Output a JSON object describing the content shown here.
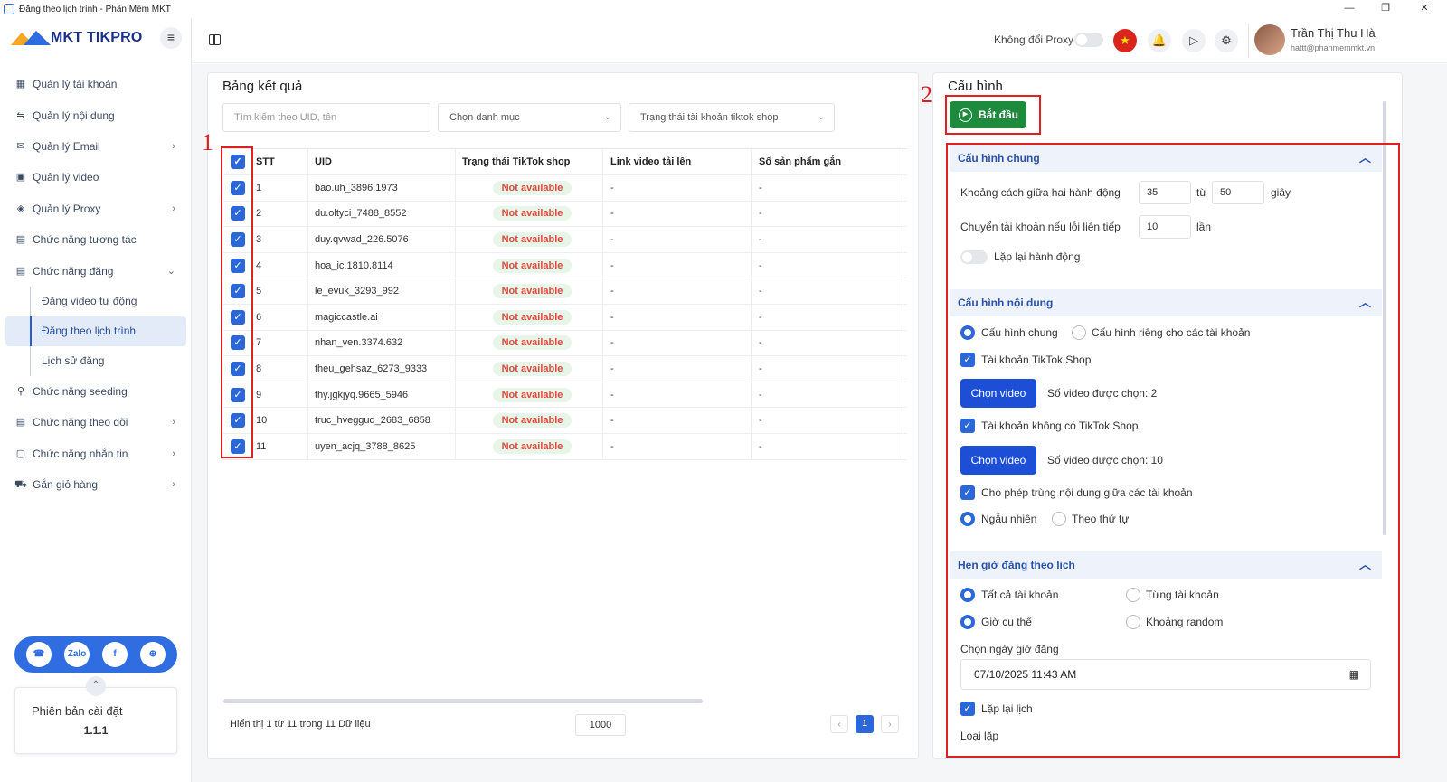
{
  "window": {
    "title": "Đăng theo lịch trình - Phần Mềm MKT",
    "minimize": "—",
    "restore": "❐",
    "close": "✕"
  },
  "brand": {
    "name": "MKT TIKPRO"
  },
  "sidebar": {
    "items": [
      {
        "label": "Quản lý tài khoản",
        "icon": "▦"
      },
      {
        "label": "Quản lý nội dung",
        "icon": "⇋"
      },
      {
        "label": "Quản lý Email",
        "icon": "✉",
        "chev": "›"
      },
      {
        "label": "Quản lý video",
        "icon": "▣"
      },
      {
        "label": "Quản lý Proxy",
        "icon": "◈",
        "chev": "›"
      },
      {
        "label": "Chức năng tương tác",
        "icon": "▤"
      },
      {
        "label": "Chức năng đăng",
        "icon": "▤",
        "chev": "⌄"
      }
    ],
    "subitems": [
      {
        "label": "Đăng video tự động"
      },
      {
        "label": "Đăng theo lịch trình"
      },
      {
        "label": "Lịch sử đăng"
      }
    ],
    "items_after": [
      {
        "label": "Chức năng seeding",
        "icon": "⚲"
      },
      {
        "label": "Chức năng theo dõi",
        "icon": "▤",
        "chev": "›"
      },
      {
        "label": "Chức năng nhắn tin",
        "icon": "▢",
        "chev": "›"
      },
      {
        "label": "Gắn giỏ hàng",
        "icon": "⛟",
        "chev": "›"
      }
    ],
    "social": [
      "☎",
      "Zalo",
      "f",
      "⊕"
    ],
    "version_label": "Phiên bản cài đặt",
    "version": "1.1.1"
  },
  "header": {
    "proxy_label": "Không đổi Proxy",
    "user_name": "Trần Thị Thu Hà",
    "user_email": "hattt@phanmemmkt.vn"
  },
  "results": {
    "title": "Bảng kết quả",
    "search_placeholder": "Tìm kiếm theo UID, tên",
    "category_select": "Chọn danh mục",
    "status_select": "Trạng thái tài khoản tiktok shop",
    "columns": [
      "STT",
      "UID",
      "Trạng thái TikTok shop",
      "Link video tải lên",
      "Số sản phẩm gắn"
    ],
    "rows": [
      {
        "stt": "1",
        "uid": "bao.uh_3896.1973",
        "status": "Not available",
        "link": "-",
        "count": "-"
      },
      {
        "stt": "2",
        "uid": "du.oltyci_7488_8552",
        "status": "Not available",
        "link": "-",
        "count": "-"
      },
      {
        "stt": "3",
        "uid": "duy.qvwad_226.5076",
        "status": "Not available",
        "link": "-",
        "count": "-"
      },
      {
        "stt": "4",
        "uid": "hoa_ic.1810.8114",
        "status": "Not available",
        "link": "-",
        "count": "-"
      },
      {
        "stt": "5",
        "uid": "le_evuk_3293_992",
        "status": "Not available",
        "link": "-",
        "count": "-"
      },
      {
        "stt": "6",
        "uid": "magiccastle.ai",
        "status": "Not available",
        "link": "-",
        "count": "-"
      },
      {
        "stt": "7",
        "uid": "nhan_ven.3374.632",
        "status": "Not available",
        "link": "-",
        "count": "-"
      },
      {
        "stt": "8",
        "uid": "theu_gehsaz_6273_9333",
        "status": "Not available",
        "link": "-",
        "count": "-"
      },
      {
        "stt": "9",
        "uid": "thy.jgkjyq.9665_5946",
        "status": "Not available",
        "link": "-",
        "count": "-"
      },
      {
        "stt": "10",
        "uid": "truc_hveggud_2683_6858",
        "status": "Not available",
        "link": "-",
        "count": "-"
      },
      {
        "stt": "11",
        "uid": "uyen_acjq_3788_8625",
        "status": "Not available",
        "link": "-",
        "count": "-"
      }
    ],
    "footer_text": "Hiển thị 1 từ 11 trong 11 Dữ liệu",
    "page_size": "1000",
    "current_page": "1",
    "prev": "‹",
    "next": "›"
  },
  "annotations": {
    "one": "1",
    "two": "2"
  },
  "config": {
    "title": "Cấu hình",
    "start_button": "Bắt đầu",
    "general": {
      "title": "Cấu hình chung",
      "delay_label": "Khoảng cách giữa hai hành động",
      "delay_from": "35",
      "from_word": "từ",
      "delay_to": "50",
      "seconds": "giây",
      "switch_label": "Chuyển tài khoản nếu lỗi liên tiếp",
      "switch_value": "10",
      "times": "lần",
      "repeat_label": "Lặp lại hành động"
    },
    "content": {
      "title": "Cấu hình nội dung",
      "opt_general": "Cấu hình chung",
      "opt_private": "Cấu hình riêng cho các tài khoản",
      "tiktok_shop_acc": "Tài khoản TikTok Shop",
      "choose_video": "Chọn video",
      "selected_shop": "Số video được chọn: 2",
      "no_shop_acc": "Tài khoản không có TikTok Shop",
      "selected_noshop": "Số video được chọn: 10",
      "allow_dup": "Cho phép trùng nội dung giữa các tài khoản",
      "random": "Ngẫu nhiên",
      "sequential": "Theo thứ tự"
    },
    "schedule": {
      "title": "Hẹn giờ đăng theo lịch",
      "all_acc": "Tất cả tài khoản",
      "each_acc": "Từng tài khoản",
      "specific_time": "Giờ cụ thể",
      "random_range": "Khoảng random",
      "pick_label": "Chọn ngày giờ đăng",
      "datetime": "07/10/2025 11:43 AM",
      "repeat_label": "Lặp lại lịch",
      "repeat_type": "Loại lặp"
    }
  }
}
